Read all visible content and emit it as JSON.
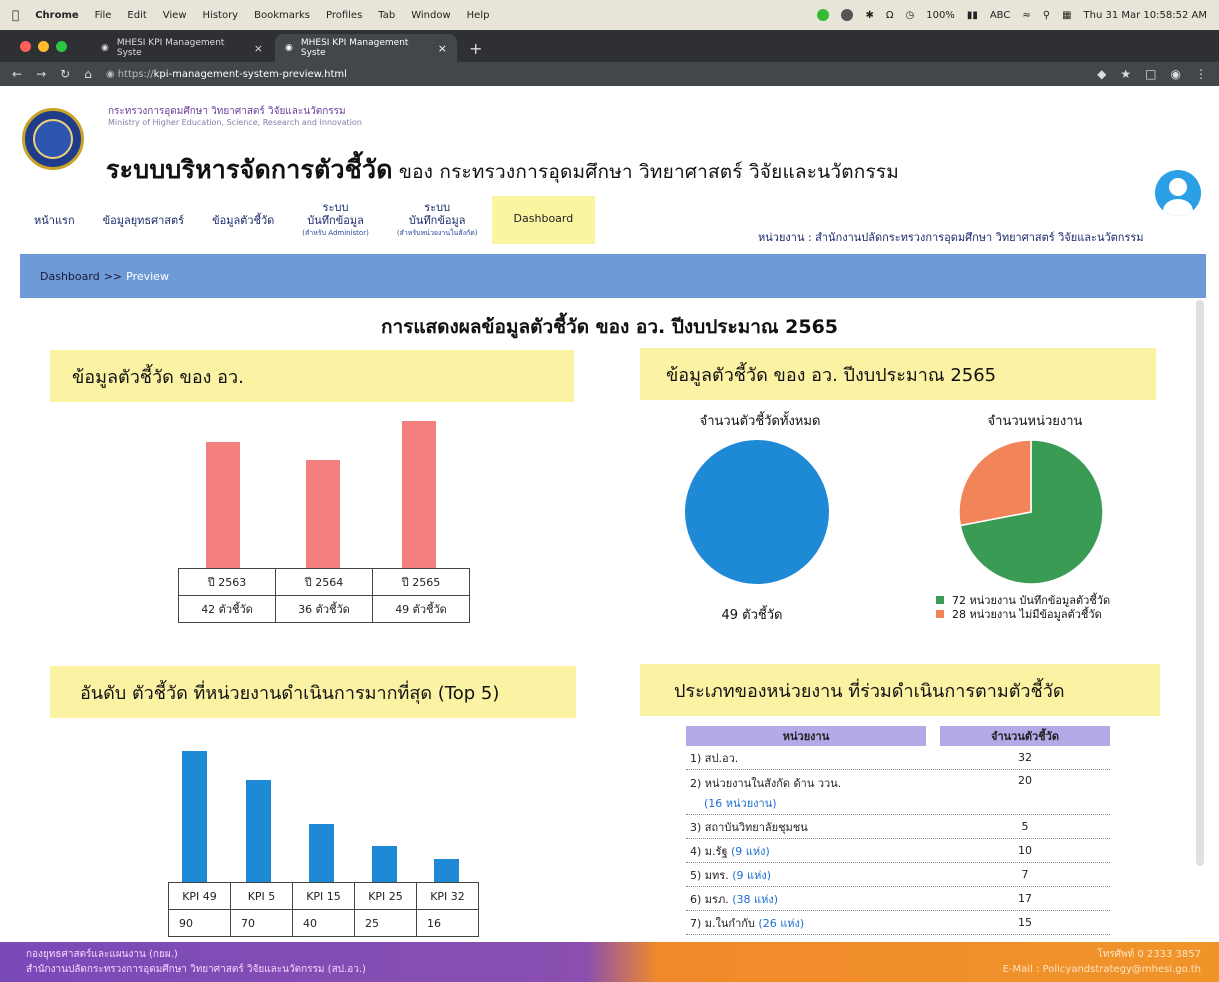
{
  "menubar": {
    "app": "Chrome",
    "items": [
      "File",
      "Edit",
      "View",
      "History",
      "Bookmarks",
      "Profiles",
      "Tab",
      "Window",
      "Help"
    ],
    "zoom": "100%",
    "input": "ABC",
    "clock": "Thu 31 Mar 10:58:52 AM"
  },
  "browser": {
    "tabs": [
      {
        "label": "MHESI KPI Management Syste"
      },
      {
        "label": "MHESI KPI Management Syste"
      }
    ],
    "url_prefix": "https://",
    "url_host": "kpi-management-system-preview.html"
  },
  "header": {
    "ministry_th": "กระทรวงการอุดมศึกษา วิทยาศาสตร์ วิจัยและนวัตกรรม",
    "ministry_en": "Ministry of Higher Education, Science, Research and Innovation",
    "title_main": "ระบบบริหารจัดการตัวชี้วัด",
    "title_sub": " ของ กระทรวงการอุดมศึกษา วิทยาศาสตร์ วิจัยและนวัตกรรม",
    "unit": "หน่วยงาน : สำนักงานปลัดกระทรวงการอุดมศึกษา วิทยาศาสตร์ วิจัยและนวัตกรรม"
  },
  "nav": {
    "home": "หน้าแรก",
    "strategy": "ข้อมูลยุทธศาสตร์",
    "kpi": "ข้อมูลตัวชี้วัด",
    "record_admin_l1": "ระบบ",
    "record_admin_l2": "บันทึกข้อมูล",
    "record_admin_l3": "(สำหรับ Administor)",
    "record_unit_l1": "ระบบ",
    "record_unit_l2": "บันทึกข้อมูล",
    "record_unit_l3": "(สำหรับหน่วยงานในสังกัด)",
    "dashboard": "Dashboard"
  },
  "breadcrumb": {
    "root": "Dashboard",
    "sep": ">>",
    "current": "Preview"
  },
  "page_title": "การแสดงผลข้อมูลตัวชี้วัด ของ อว. ปีงบประมาณ 2565",
  "sections": {
    "kpi_data": "ข้อมูลตัวชี้วัด ของ อว.",
    "kpi_2565": "ข้อมูลตัวชี้วัด ของ อว. ปีงบประมาณ 2565",
    "top5": "อันดับ ตัวชี้วัด ที่หน่วยงานดำเนินการมากที่สุด (Top 5)",
    "unit_types": "ประเภทของหน่วยงาน ที่ร่วมดำเนินการตามตัวชี้วัด"
  },
  "chart_data": [
    {
      "type": "bar",
      "categories": [
        "ปี 2563",
        "ปี 2564",
        "ปี 2565"
      ],
      "values": [
        42,
        36,
        49
      ],
      "value_labels": [
        "42 ตัวชี้วัด",
        "36 ตัวชี้วัด",
        "49 ตัวชี้วัด"
      ],
      "color": "#f47f7f",
      "ylim": [
        0,
        52
      ]
    },
    {
      "type": "pie",
      "title": "จำนวนตัวชี้วัดทั้งหมด",
      "values": [
        49
      ],
      "colors": [
        "#1e8ad6"
      ],
      "caption": "49 ตัวชี้วัด"
    },
    {
      "type": "pie",
      "title": "จำนวนหน่วยงาน",
      "values": [
        72,
        28
      ],
      "colors": [
        "#3a9b55",
        "#f2845a"
      ],
      "legend": [
        "72 หน่วยงาน บันทึกข้อมูลตัวชี้วัด",
        "28 หน่วยงาน ไม่มีข้อมูลตัวชี้วัด"
      ]
    },
    {
      "type": "bar",
      "categories": [
        "KPI 49",
        "KPI 5",
        "KPI 15",
        "KPI 25",
        "KPI 32"
      ],
      "values": [
        90,
        70,
        40,
        25,
        16
      ],
      "color": "#1e8ad6",
      "ylim": [
        0,
        95
      ]
    }
  ],
  "unit_table": {
    "headers": [
      "หน่วยงาน",
      "จำนวนตัวชี้วัด"
    ],
    "rows": [
      {
        "name": "1) สป.อว.",
        "extra": "",
        "value": "32"
      },
      {
        "name": "2) หน่วยงานในสังกัด ด้าน ววน.",
        "extra": "(16 หน่วยงาน)",
        "value": "20"
      },
      {
        "name": "3) สถาบันวิทยาลัยชุมชน",
        "extra": "",
        "value": "5"
      },
      {
        "name": "4) ม.รัฐ ",
        "extra": "(9 แห่ง)",
        "value": "10"
      },
      {
        "name": "5) มทร. ",
        "extra": "(9 แห่ง)",
        "value": "7"
      },
      {
        "name": "6) มรภ. ",
        "extra": "(38 แห่ง)",
        "value": "17"
      },
      {
        "name": "7) ม.ในกำกับ ",
        "extra": "(26 แห่ง)",
        "value": "15"
      }
    ]
  },
  "footer": {
    "left_1": "กองยุทธศาสตร์และแผนงาน (กยผ.)",
    "left_2": "สำนักงานปลัดกระทรวงการอุดมศึกษา วิทยาศาสตร์ วิจัยและนวัตกรรม (สป.อว.)",
    "phone": "โทรศัพท์ 0 2333 3857",
    "email": "E-Mail : Policyandstrategy@mhesi.go.th"
  }
}
